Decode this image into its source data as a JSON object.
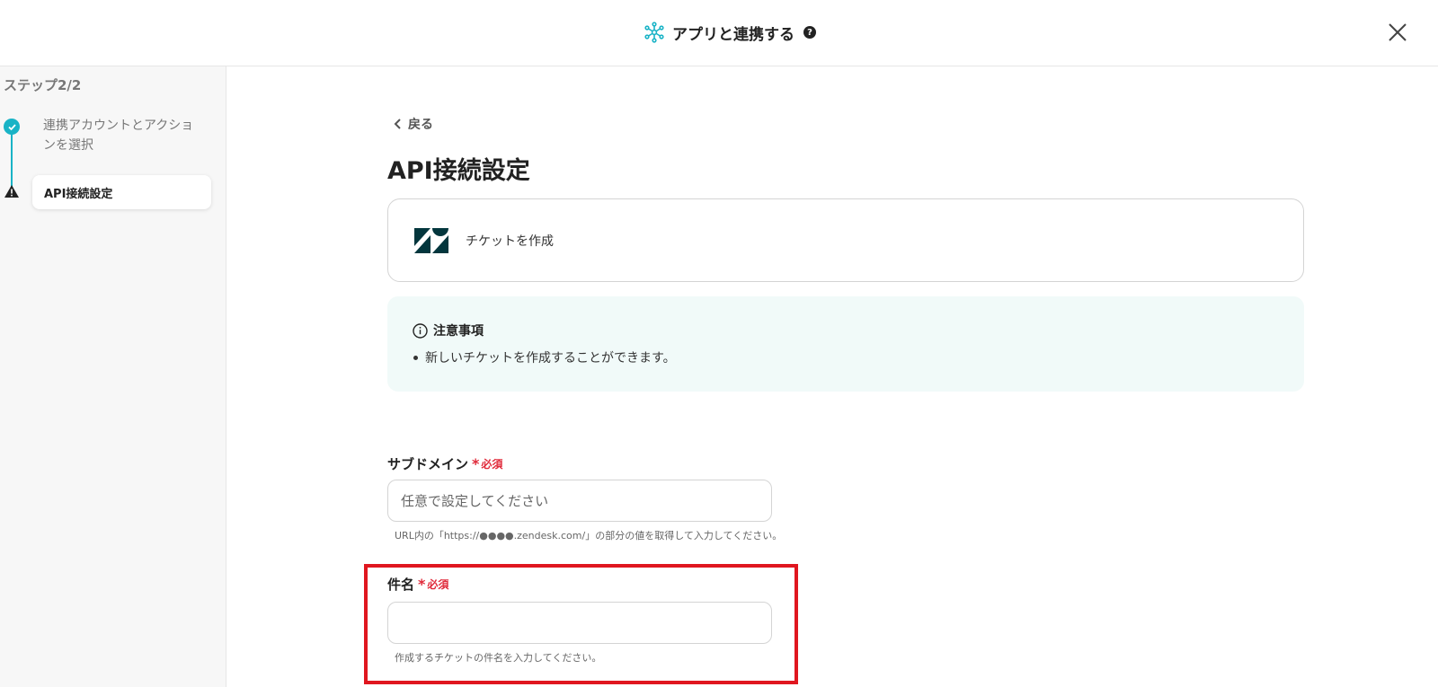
{
  "header": {
    "title": "アプリと連携する",
    "help_symbol": "?"
  },
  "sidebar": {
    "step_count": "ステップ2/2",
    "steps": [
      {
        "label": "連携アカウントとアクションを選択",
        "status": "complete"
      },
      {
        "label": "API接続設定",
        "status": "warning"
      }
    ]
  },
  "main": {
    "back_label": "戻る",
    "page_title": "API接続設定",
    "app_card": {
      "action_label": "チケットを作成",
      "logo": "zendesk-logo",
      "logo_color": "#03363d"
    },
    "notice": {
      "title": "注意事項",
      "items": [
        "新しいチケットを作成することができます。"
      ]
    },
    "fields": [
      {
        "label": "サブドメイン",
        "required_label": "必須",
        "value": "",
        "placeholder": "任意で設定してください",
        "hint": "URL内の「https://●●●●.zendesk.com/」の部分の値を取得して入力してください。"
      },
      {
        "label": "件名",
        "required_label": "必須",
        "value": "",
        "placeholder": "",
        "hint": "作成するチケットの件名を入力してください。"
      }
    ]
  },
  "colors": {
    "accent": "#19b3c6",
    "required": "#e02a3a",
    "notice_bg": "#f1faf9",
    "highlight": "#e0161f"
  }
}
